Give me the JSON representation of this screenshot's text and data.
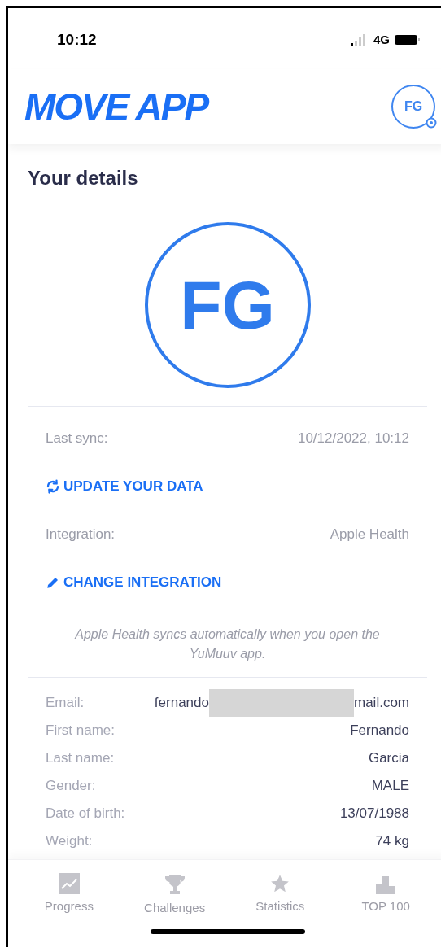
{
  "status_bar": {
    "time": "10:12",
    "network": "4G"
  },
  "header": {
    "logo": "MOVE APP",
    "avatar_initials": "FG"
  },
  "title": "Your details",
  "profile": {
    "initials": "FG"
  },
  "sync": [
    {
      "kind": "row",
      "label": "Last sync:",
      "value": "10/12/2022, 10:12"
    },
    {
      "kind": "action",
      "label": "UPDATE YOUR DATA"
    },
    {
      "kind": "row",
      "label": "Integration:",
      "value": "Apple Health"
    },
    {
      "kind": "action",
      "label": "CHANGE INTEGRATION"
    },
    {
      "kind": "note",
      "label": "Apple Health syncs automatically when you open the YuMuuv app."
    }
  ],
  "details": [
    {
      "label": "Email:",
      "value": "fernando",
      "value_end": "mail.com",
      "redacted": true
    },
    {
      "label": "First name:",
      "value": "Fernando"
    },
    {
      "label": "Last name:",
      "value": "Garcia"
    },
    {
      "label": "Gender:",
      "value": "MALE"
    },
    {
      "label": "Date of birth:",
      "value": "13/07/1988"
    },
    {
      "label": "Weight:",
      "value": "74 kg"
    }
  ],
  "tab_bar": [
    {
      "label": "Progress",
      "selected": false
    },
    {
      "label": "Challenges",
      "selected": false
    },
    {
      "label": "Statistics",
      "selected": false
    },
    {
      "label": "TOP 100",
      "selected": false
    }
  ]
}
